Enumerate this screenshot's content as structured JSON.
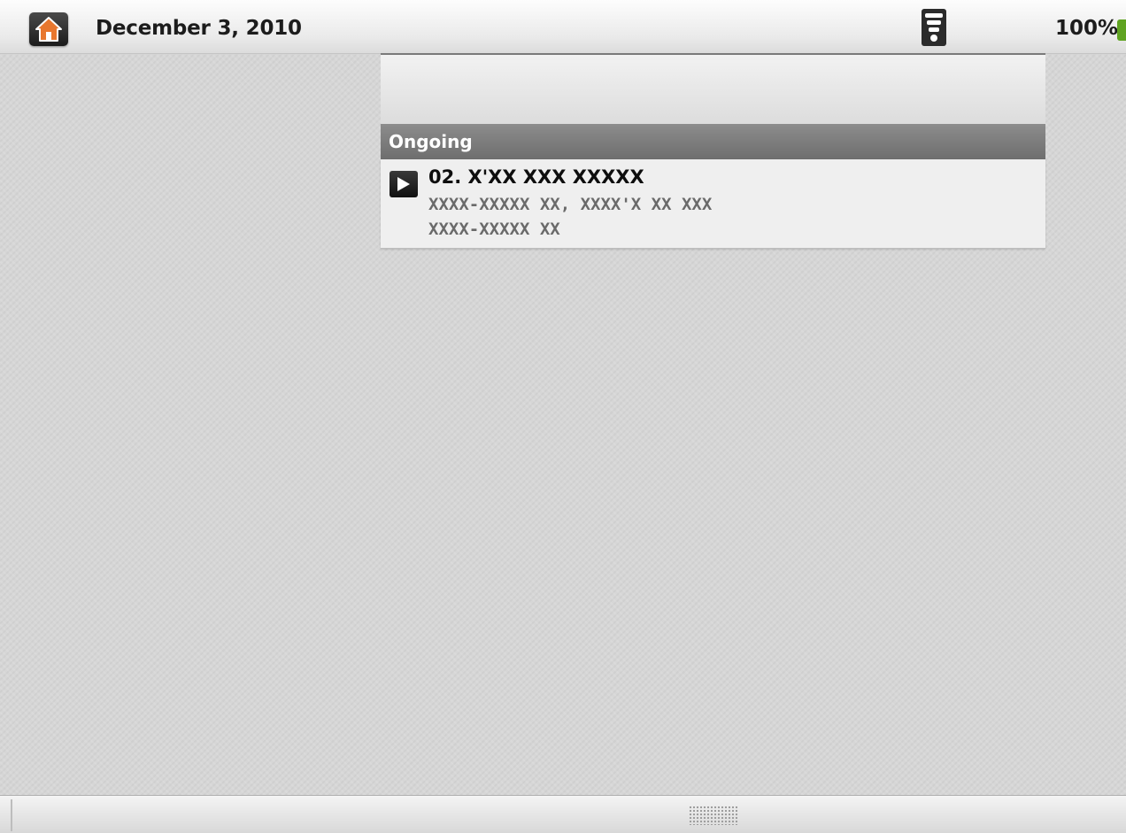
{
  "status_bar": {
    "date": "December 3, 2010",
    "battery_percent": "100%",
    "home_icon": "home-icon",
    "signal_icon": "wifi-signal-icon",
    "battery_icon": "battery-icon",
    "battery_color": "#5fa321"
  },
  "notification_panel": {
    "section_title": "Ongoing",
    "items": [
      {
        "icon": "play-icon",
        "title": "02. X'XX XXX XXXXX",
        "line1": "XXXX-XXXXX XX, XXXX'X XX XXX",
        "line2": "XXXX-XXXXX XX"
      }
    ]
  },
  "bottom_bar": {
    "handle_icon": "drag-grip-icon"
  }
}
